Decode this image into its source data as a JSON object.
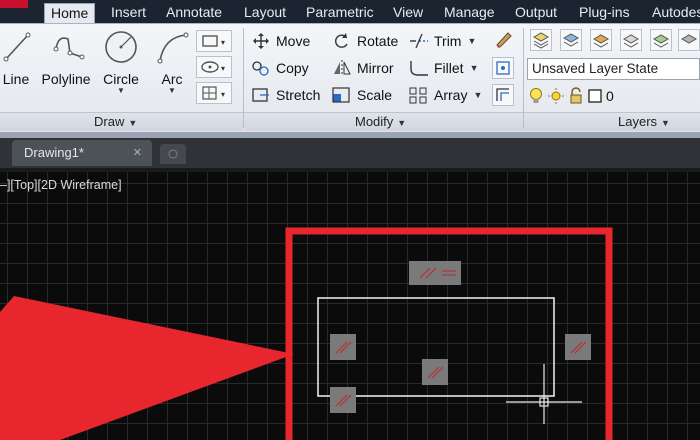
{
  "ribbon": {
    "tabs": [
      {
        "label": "Home",
        "active": true
      },
      {
        "label": "Insert"
      },
      {
        "label": "Annotate"
      },
      {
        "label": "Layout"
      },
      {
        "label": "Parametric"
      },
      {
        "label": "View"
      },
      {
        "label": "Manage"
      },
      {
        "label": "Output"
      },
      {
        "label": "Plug-ins"
      },
      {
        "label": "Autodes"
      }
    ],
    "panels": {
      "draw": {
        "title": "Draw",
        "tools": {
          "line": "Line",
          "polyline": "Polyline",
          "circle": "Circle",
          "arc": "Arc"
        }
      },
      "modify": {
        "title": "Modify",
        "tools": {
          "move": "Move",
          "copy": "Copy",
          "stretch": "Stretch",
          "rotate": "Rotate",
          "mirror": "Mirror",
          "scale": "Scale",
          "trim": "Trim",
          "fillet": "Fillet",
          "array": "Array"
        }
      },
      "layers": {
        "title": "Layers",
        "layer_state": "Unsaved Layer State",
        "current_layer": "0"
      }
    }
  },
  "file_tabs": {
    "active_label": "Drawing1*",
    "close_glyph": "✕"
  },
  "viewport": {
    "label": "–][Top][2D Wireframe]"
  },
  "colors": {
    "ribbon_tab_bar": "#1c2331",
    "canvas_background": "#0b0b0c",
    "highlight_red": "#e8262d",
    "grip_gray": "#7a7a7a",
    "selected_rect": "#e6e6e6"
  },
  "icons": [
    "app-logo",
    "line-icon",
    "polyline-icon",
    "circle-icon",
    "arc-icon",
    "rectangle-icon",
    "hatch-icon",
    "move-icon",
    "rotate-icon",
    "trim-icon",
    "copy-icon",
    "mirror-icon",
    "fillet-icon",
    "stretch-icon",
    "scale-icon",
    "array-icon",
    "layer-properties-icon",
    "lightbulb-icon",
    "sun-icon",
    "lock-icon",
    "color-swatch-icon",
    "annotation-arrow",
    "crosshair-cursor"
  ]
}
